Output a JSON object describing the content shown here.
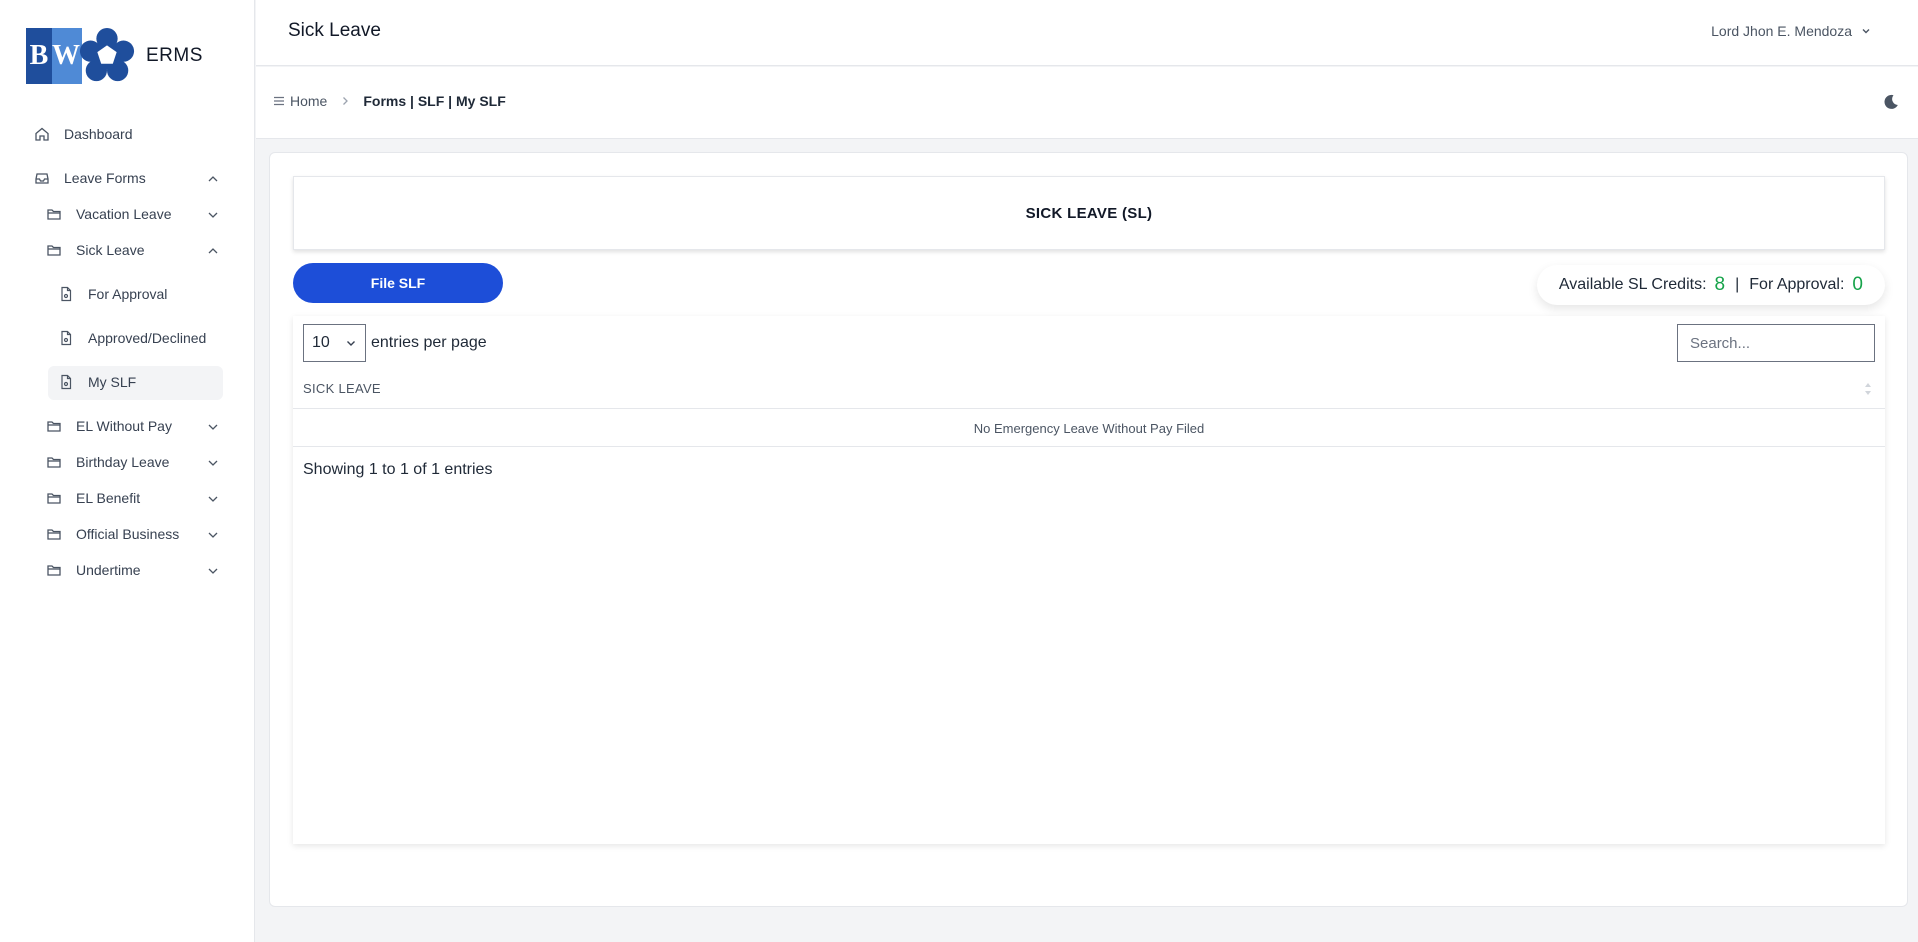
{
  "brand": {
    "logo_b": "B",
    "logo_w": "W",
    "name": "ERMS"
  },
  "sidebar": {
    "dashboard": "Dashboard",
    "leave_forms": "Leave Forms",
    "vacation_leave": "Vacation Leave",
    "sick_leave": "Sick Leave",
    "for_approval": "For Approval",
    "approved_declined": "Approved/Declined",
    "my_slf": "My SLF",
    "el_without_pay": "EL Without Pay",
    "birthday_leave": "Birthday Leave",
    "el_benefit": "EL Benefit",
    "official_business": "Official Business",
    "undertime": "Undertime"
  },
  "header": {
    "title": "Sick Leave",
    "user_name": "Lord Jhon E. Mendoza"
  },
  "breadcrumb": {
    "home": "Home",
    "current": "Forms | SLF | My SLF"
  },
  "content": {
    "section_title": "SICK LEAVE (SL)",
    "file_button": "File SLF",
    "credits_label": "Available SL Credits:",
    "credits_value": "8",
    "separator": "|",
    "approval_label": "For Approval:",
    "approval_value": "0"
  },
  "table": {
    "per_page_value": "10",
    "per_page_label": "entries per page",
    "search_placeholder": "Search...",
    "column_header": "SICK LEAVE",
    "empty_message": "No Emergency Leave Without Pay Filed",
    "info": "Showing 1 to 1 of 1 entries"
  },
  "colors": {
    "primary": "#1d4ed8",
    "success": "#16a34a",
    "brand_dark": "#1f4e9c",
    "brand_light": "#4f8ad6"
  }
}
